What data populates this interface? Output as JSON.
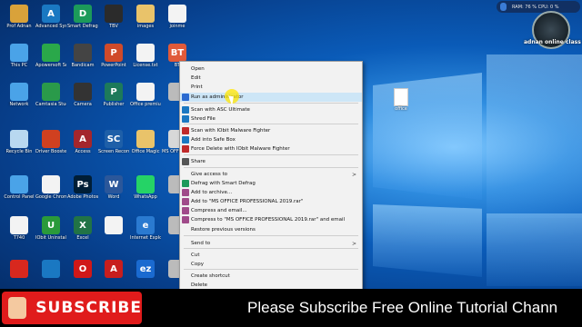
{
  "overlay": {
    "ram_text": "RAM: 76 %  CPU: 0 %",
    "brand": "adnan online class"
  },
  "banner": {
    "subscribe": "SUBSCRIBE",
    "scroll_text": "Please Subscribe Free Online Tutorial Chann"
  },
  "desktop_file": "office",
  "icons": [
    {
      "label": "Prof Adnan",
      "color": "#d9a23a",
      "glyph": "",
      "icon": "user-folder-icon"
    },
    {
      "label": "Advanced SystemCa...",
      "color": "#1a78c2",
      "glyph": "A",
      "icon": "advanced-systemcare-icon"
    },
    {
      "label": "Smart Defrag 6",
      "color": "#1c9a5a",
      "glyph": "D",
      "icon": "smart-defrag-icon"
    },
    {
      "label": "TBV",
      "color": "#2b2b2b",
      "glyph": "",
      "icon": "tbv-icon"
    },
    {
      "label": "images",
      "color": "#e9c36a",
      "glyph": "",
      "icon": "images-folder-icon"
    },
    {
      "label": "joinme",
      "color": "#f3f3f3",
      "glyph": "",
      "icon": "joinme-icon"
    },
    {
      "label": "This PC",
      "color": "#4aa3e8",
      "glyph": "",
      "icon": "this-pc-icon"
    },
    {
      "label": "Apowersoft Screen Reco...",
      "color": "#2aa84a",
      "glyph": "",
      "icon": "apowersoft-icon"
    },
    {
      "label": "Bandicam",
      "color": "#444",
      "glyph": "",
      "icon": "bandicam-icon"
    },
    {
      "label": "PowerPoint",
      "color": "#d04a2a",
      "glyph": "P",
      "icon": "powerpoint-icon"
    },
    {
      "label": "License.txt",
      "color": "#f3f3f3",
      "glyph": "",
      "icon": "text-file-icon"
    },
    {
      "label": "BT",
      "color": "#e05a3a",
      "glyph": "BT",
      "icon": "bt-icon"
    },
    {
      "label": "Network",
      "color": "#4aa3e8",
      "glyph": "",
      "icon": "network-icon"
    },
    {
      "label": "Camtasia Studio 8",
      "color": "#2a9a4a",
      "glyph": "",
      "icon": "camtasia-icon"
    },
    {
      "label": "Camera",
      "color": "#333",
      "glyph": "",
      "icon": "camera-icon"
    },
    {
      "label": "Publisher",
      "color": "#1d7a5a",
      "glyph": "P",
      "icon": "publisher-icon"
    },
    {
      "label": "Office premium",
      "color": "#f3f3f3",
      "glyph": "",
      "icon": "office-file-icon"
    },
    {
      "label": "",
      "color": "#bbb",
      "glyph": "",
      "icon": "desktop-item-icon"
    },
    {
      "label": "Recycle Bin",
      "color": "#b8d8f0",
      "glyph": "",
      "icon": "recycle-bin-icon"
    },
    {
      "label": "Driver Booster 6",
      "color": "#d04020",
      "glyph": "",
      "icon": "driver-booster-icon"
    },
    {
      "label": "Access",
      "color": "#a4262c",
      "glyph": "A",
      "icon": "access-icon"
    },
    {
      "label": "Screen Recorder",
      "color": "#1e5fa8",
      "glyph": "SC",
      "icon": "screen-recorder-icon"
    },
    {
      "label": "Office Magic",
      "color": "#e9c36a",
      "glyph": "",
      "icon": "office-magic-icon"
    },
    {
      "label": "MS OFFICE PRO...",
      "color": "#d8d8d8",
      "glyph": "",
      "icon": "ms-office-archive-icon"
    },
    {
      "label": "Control Panel",
      "color": "#4aa3e8",
      "glyph": "",
      "icon": "control-panel-icon"
    },
    {
      "label": "Google Chrome",
      "color": "#f3f3f3",
      "glyph": "",
      "icon": "chrome-icon"
    },
    {
      "label": "Adobe Photoshop",
      "color": "#001e36",
      "glyph": "Ps",
      "icon": "photoshop-icon"
    },
    {
      "label": "Word",
      "color": "#2b579a",
      "glyph": "W",
      "icon": "word-icon"
    },
    {
      "label": "WhatsApp",
      "color": "#25d366",
      "glyph": "",
      "icon": "whatsapp-icon"
    },
    {
      "label": "",
      "color": "#bbb",
      "glyph": "",
      "icon": "desktop-item-icon"
    },
    {
      "label": "T740",
      "color": "#f3f3f3",
      "glyph": "",
      "icon": "text-file-icon"
    },
    {
      "label": "IObit Uninstaller",
      "color": "#2a9a3a",
      "glyph": "U",
      "icon": "iobit-uninstaller-icon"
    },
    {
      "label": "Excel",
      "color": "#217346",
      "glyph": "X",
      "icon": "excel-icon"
    },
    {
      "label": "",
      "color": "#f3f3f3",
      "glyph": "",
      "icon": "text-file-icon"
    },
    {
      "label": "Internet Explorer",
      "color": "#2a7ad0",
      "glyph": "e",
      "icon": "internet-explorer-icon"
    },
    {
      "label": "",
      "color": "#bbb",
      "glyph": "",
      "icon": "desktop-item-icon"
    },
    {
      "label": "",
      "color": "#d8281e",
      "glyph": "",
      "icon": "pdf-icon"
    },
    {
      "label": "",
      "color": "#1a78c2",
      "glyph": "",
      "icon": "app-icon"
    },
    {
      "label": "",
      "color": "#d01818",
      "glyph": "O",
      "icon": "opera-icon"
    },
    {
      "label": "",
      "color": "#c81e1e",
      "glyph": "A",
      "icon": "adobe-icon"
    },
    {
      "label": "",
      "color": "#1a6ad0",
      "glyph": "ez",
      "icon": "ez-icon"
    },
    {
      "label": "",
      "color": "#bbb",
      "glyph": "",
      "icon": "desktop-item-icon"
    }
  ],
  "context_menu": [
    {
      "label": "Open",
      "icon": "",
      "arrow": ""
    },
    {
      "label": "Edit",
      "icon": "",
      "arrow": ""
    },
    {
      "label": "Print",
      "icon": "",
      "arrow": ""
    },
    {
      "label": "Run as administrator",
      "icon": "shield-icon",
      "color": "#2a6ad0",
      "arrow": ""
    },
    {
      "label": "Scan with ASC Ultimate",
      "icon": "scan-icon",
      "color": "#1a78c2",
      "arrow": ""
    },
    {
      "label": "Shred File",
      "icon": "shred-icon",
      "color": "#1a78c2",
      "arrow": ""
    },
    {
      "label": "Scan with IObit Malware Fighter",
      "icon": "malware-fighter-icon",
      "color": "#c02a2a",
      "arrow": ""
    },
    {
      "label": "Add into Safe Box",
      "icon": "safe-box-icon",
      "color": "#1a78c2",
      "arrow": ""
    },
    {
      "label": "Force Delete with IObit Malware Fighter",
      "icon": "force-delete-icon",
      "color": "#c02a2a",
      "arrow": ""
    },
    {
      "label": "Share",
      "icon": "share-icon",
      "color": "#555",
      "arrow": ""
    },
    {
      "label": "Give access to",
      "icon": "",
      "arrow": ">"
    },
    {
      "label": "Defrag with Smart Defrag",
      "icon": "defrag-icon",
      "color": "#1c9a5a",
      "arrow": ""
    },
    {
      "label": "Add to archive...",
      "icon": "archive-icon",
      "color": "#a04a8a",
      "arrow": ""
    },
    {
      "label": "Add to \"MS OFFICE PROFESSIONAL 2019.rar\"",
      "icon": "archive-icon",
      "color": "#a04a8a",
      "arrow": ""
    },
    {
      "label": "Compress and email...",
      "icon": "archive-icon",
      "color": "#a04a8a",
      "arrow": ""
    },
    {
      "label": "Compress to \"MS OFFICE PROFESSIONAL 2019.rar\" and email",
      "icon": "archive-icon",
      "color": "#a04a8a",
      "arrow": ""
    },
    {
      "label": "Restore previous versions",
      "icon": "",
      "arrow": ""
    },
    {
      "label": "Send to",
      "icon": "",
      "arrow": ">"
    },
    {
      "label": "Cut",
      "icon": "",
      "arrow": ""
    },
    {
      "label": "Copy",
      "icon": "",
      "arrow": ""
    },
    {
      "label": "Create shortcut",
      "icon": "",
      "arrow": ""
    },
    {
      "label": "Delete",
      "icon": "",
      "arrow": ""
    }
  ]
}
